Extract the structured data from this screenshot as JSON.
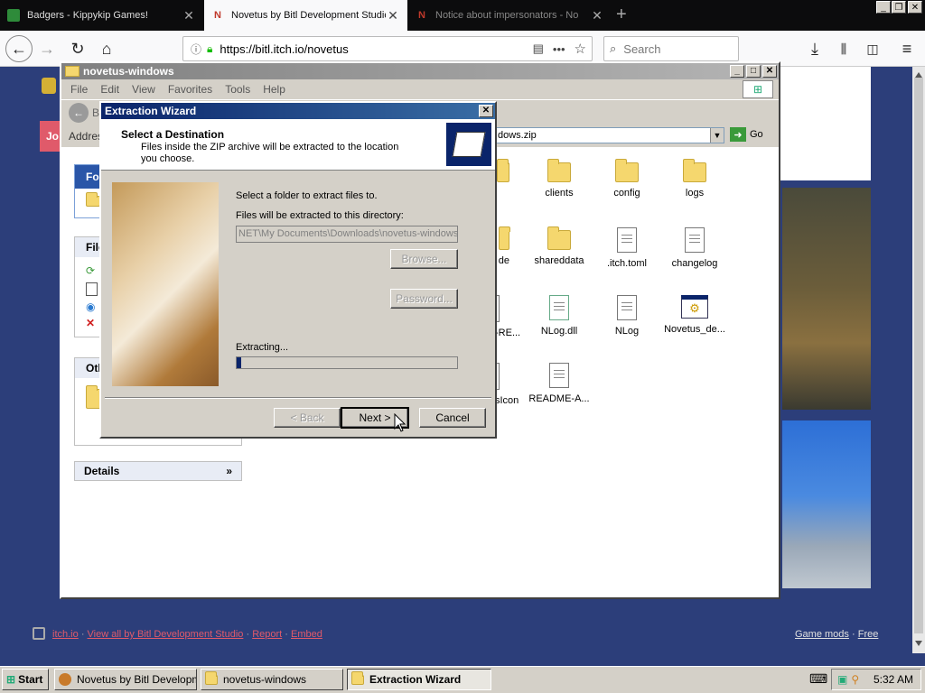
{
  "browser": {
    "tabs": [
      {
        "label": "Badgers - Kippykip Games!"
      },
      {
        "label": "Novetus by Bitl Development Studio"
      },
      {
        "label": "Notice about impersonators - No"
      }
    ],
    "url": "https://bitl.itch.io/novetus",
    "search_placeholder": "Search"
  },
  "explorer": {
    "title": "novetus-windows",
    "menu": [
      "File",
      "Edit",
      "View",
      "Favorites",
      "Tools",
      "Help"
    ],
    "back_partial": "B",
    "address_label": "Addres",
    "address_value": "dows.zip",
    "go_label": "Go",
    "left_panels": {
      "folders_partial": "Fol",
      "file_tasks_partial": "File",
      "other_places_partial": "Oth",
      "details": "Details"
    },
    "files": [
      {
        "name": "clients",
        "kind": "folder"
      },
      {
        "name": "config",
        "kind": "folder"
      },
      {
        "name": "logs",
        "kind": "folder"
      },
      {
        "name": "de",
        "kind": "folder-partial"
      },
      {
        "name": "shareddata",
        "kind": "folder"
      },
      {
        "name": ".itch.toml",
        "kind": "file"
      },
      {
        "name": "changelog",
        "kind": "file"
      },
      {
        "name": "-RE...",
        "kind": "file-partial"
      },
      {
        "name": "NLog.dll",
        "kind": "file"
      },
      {
        "name": "NLog",
        "kind": "file"
      },
      {
        "name": "Novetus_de...",
        "kind": "exe"
      },
      {
        "name": "sIcon",
        "kind": "file-partial"
      },
      {
        "name": "README-A...",
        "kind": "file"
      }
    ]
  },
  "wizard": {
    "title": "Extraction Wizard",
    "heading": "Select a Destination",
    "subheading": "Files inside the ZIP archive will be extracted to the location you choose.",
    "prompt": "Select a folder to extract files to.",
    "dir_label": "Files will be extracted to this directory:",
    "dir_value": "NET\\My Documents\\Downloads\\novetus-windows",
    "browse": "Browse...",
    "password": "Password...",
    "extracting": "Extracting...",
    "progress": 0.02,
    "back": "< Back",
    "next": "Next >",
    "cancel": "Cancel"
  },
  "page": {
    "footer_links": [
      "itch.io",
      "View all by Bitl Development Studio",
      "Report",
      "Embed"
    ],
    "footer_right": [
      "Game mods",
      "Free"
    ],
    "join_partial": "Jo"
  },
  "taskbar": {
    "start": "Start",
    "items": [
      "Novetus by Bitl Developm...",
      "novetus-windows",
      "Extraction Wizard"
    ],
    "clock": "5:32 AM"
  },
  "colors": {
    "title_active": "#0a246a",
    "title_inactive": "#808080",
    "page_bg": "#2c3e7a",
    "accent_red": "#e05a6a"
  }
}
